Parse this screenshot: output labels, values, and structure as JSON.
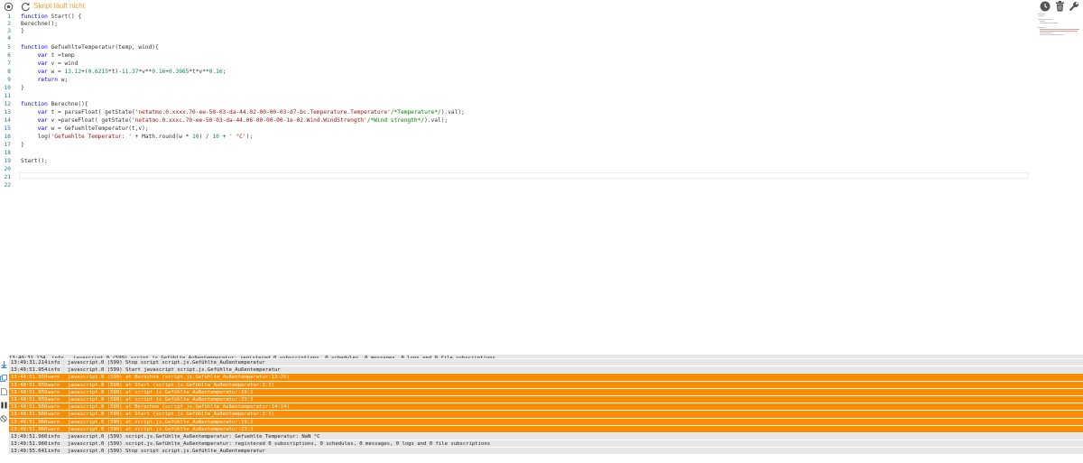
{
  "toolbar": {
    "status": "Skript läuft nicht",
    "status_color": "#f0a030",
    "left_icons": [
      "target-icon",
      "refresh-icon"
    ],
    "right_icons": [
      "clock-icon",
      "trash-icon",
      "wrench-icon"
    ]
  },
  "editor": {
    "lines": [
      {
        "n": "1",
        "code": "function Start() {"
      },
      {
        "n": "2",
        "code": "Berechne();"
      },
      {
        "n": "3",
        "code": "}"
      },
      {
        "n": "4",
        "code": ""
      },
      {
        "n": "5",
        "code": "function GefuehlteTemperatur(temp, wind){"
      },
      {
        "n": "6",
        "code": "     var t =temp"
      },
      {
        "n": "7",
        "code": "     var v = wind"
      },
      {
        "n": "8",
        "code": "     var w = 13.12+(0.6215*t)-11.37*v**0.16+0.3965*t*v**0.16;"
      },
      {
        "n": "9",
        "code": "     return w;"
      },
      {
        "n": "10",
        "code": "}"
      },
      {
        "n": "11",
        "code": ""
      },
      {
        "n": "12",
        "code": "function Berechne(){"
      },
      {
        "n": "13",
        "code": "     var t = parseFloat( getState('netatmo.0.xxxx.70-ee-50-03-da-44.02-00-00-03-d7-bc.Temperature.Temperature'/*Temperature*/).val);"
      },
      {
        "n": "14",
        "code": "     var v =parseFloat( getState('netatmo.0.xxxc.70-ee-50-03-da-44.06-00-00-00-1e-02.Wind.WindStrength'/*Wind strength*/).val);"
      },
      {
        "n": "15",
        "code": "     var w = GefuehlteTemperatur(t,v);"
      },
      {
        "n": "16",
        "code": "     log('Gefuehlte Temperatur: ' + Math.round(w * 10) / 10 + ' °C');"
      },
      {
        "n": "17",
        "code": "}"
      },
      {
        "n": "18",
        "code": ""
      },
      {
        "n": "19",
        "code": "Start();"
      },
      {
        "n": "20",
        "code": ""
      },
      {
        "n": "21",
        "code": ""
      },
      {
        "n": "22",
        "code": ""
      }
    ]
  },
  "log": {
    "partial_row": "13:49:31.134  info   javascript.0 (599) script.js.Gefühlte_Außentemperatur: registered 0 subscriptions, 0 schedules, 0 messages, 0 logs and 0 file subscriptions",
    "rows": [
      {
        "time": "13:49:31.214",
        "level": "info",
        "msg": "javascript.0 (599) Stop script script.js.Gefühlte_Außentemperatur"
      },
      {
        "time": "13:49:51.954",
        "level": "info",
        "msg": "javascript.0 (599) Start javascript script.js.Gefühlte_Außentemperatur"
      },
      {
        "time": "13:49:51.959",
        "level": "warn",
        "msg": "javascript.0 (599) at Berechne (script.js.Gefühlte_Außentemperatur:13:25)"
      },
      {
        "time": "13:49:51.959",
        "level": "warn",
        "msg": "javascript.0 (599) at Start (script.js.Gefühlte_Außentemperatur:2:1)"
      },
      {
        "time": "13:49:51.959",
        "level": "warn",
        "msg": "javascript.0 (599) at script.js.Gefühlte_Außentemperatur:19:1"
      },
      {
        "time": "13:49:51.959",
        "level": "warn",
        "msg": "javascript.0 (599) at script.js.Gefühlte_Außentemperatur:23:3"
      },
      {
        "time": "13:49:51.960",
        "level": "warn",
        "msg": "javascript.0 (599) at Berechne (script.js.Gefühlte_Außentemperatur:14:24)"
      },
      {
        "time": "13:49:51.960",
        "level": "warn",
        "msg": "javascript.0 (599) at Start (script.js.Gefühlte_Außentemperatur:2:1)"
      },
      {
        "time": "13:49:51.960",
        "level": "warn",
        "msg": "javascript.0 (599) at script.js.Gefühlte_Außentemperatur:19:1"
      },
      {
        "time": "13:49:51.960",
        "level": "warn",
        "msg": "javascript.0 (599) at script.js.Gefühlte_Außentemperatur:23:3"
      },
      {
        "time": "13:49:51.960",
        "level": "info",
        "msg": "javascript.0 (599) script.js.Gefühlte_Außentemperatur: Gefuehlte Temperatur: NaN °C"
      },
      {
        "time": "13:49:51.960",
        "level": "info",
        "msg": "javascript.0 (599) script.js.Gefühlte_Außentemperatur: registered 0 subscriptions, 0 schedules, 0 messages, 0 logs and 0 file subscriptions"
      },
      {
        "time": "13:49:55.641",
        "level": "info",
        "msg": "javascript.0 (599) Stop script script.js.Gefühlte_Außentemperatur"
      }
    ],
    "side_icons": [
      "scroll-down-icon",
      "copy-icon",
      "document-icon",
      "pause-icon",
      "clear-icon"
    ],
    "warn_color": "#ff8c00",
    "info_color": "#e6e6e6"
  }
}
